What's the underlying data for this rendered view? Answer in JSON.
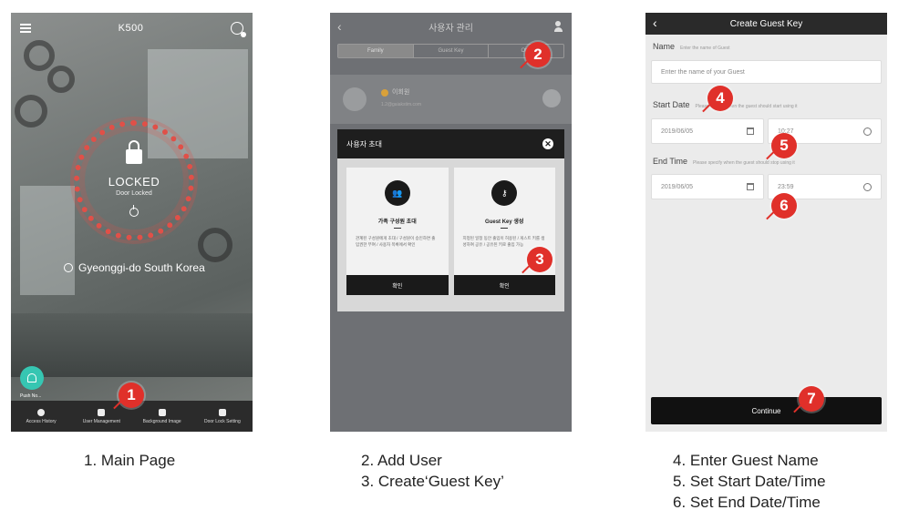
{
  "screen1": {
    "title": "K500",
    "lock_status": "LOCKED",
    "lock_sub": "Door Locked",
    "location": "Gyeonggi-do South Korea",
    "fab_label": "Push No...",
    "tabs": [
      {
        "label": "Access History",
        "icon": "clock-icon"
      },
      {
        "label": "User Management",
        "icon": "users-icon"
      },
      {
        "label": "Background Image",
        "icon": "image-icon"
      },
      {
        "label": "Door Lock Setting",
        "icon": "settings-icon"
      }
    ],
    "marker": "1"
  },
  "screen2": {
    "title": "사용자 관리",
    "segments": [
      "Family",
      "Guest Key",
      "Ot..."
    ],
    "member_name": "이회원",
    "member_email": "1.2@gaiakstim.com",
    "dialog_title": "사용자 초대",
    "cards": [
      {
        "title": "가족 구성원 초대",
        "desc": "관계된 구성원에게 초대 / 구성원이 승인하면 출입권한 부여 / 사용자 목록에서 확인",
        "button": "확인",
        "icon": "users-icon"
      },
      {
        "title": "Guest Key 생성",
        "desc": "지정된 일정 동안 출입이 허용된 / 게스트 키를 생성하여 공유 / 공유된 키로 출입 가능",
        "button": "확인",
        "icon": "key-icon"
      }
    ],
    "markers": [
      "2",
      "3"
    ]
  },
  "screen3": {
    "title": "Create Guest Key",
    "name_label": "Name",
    "name_hint": "Enter the name of Guest",
    "name_placeholder": "Enter the name of your Guest",
    "start_label": "Start Date",
    "start_hint": "Please specify when the guest should start using it",
    "start_date": "2019/06/05",
    "start_time": "10:27",
    "end_label": "End Time",
    "end_hint": "Please specify when the guest should stop using it",
    "end_date": "2019/06/05",
    "end_time": "23:59",
    "continue_label": "Continue",
    "markers": [
      "4",
      "5",
      "6",
      "7"
    ]
  },
  "captions": {
    "c1": "1. Main Page",
    "c2_line1": "2. Add User",
    "c2_line2": "3. Create‘Guest Key’",
    "c3_line1": "4. Enter Guest Name",
    "c3_line2": "5. Set Start Date/Time",
    "c3_line3": "6. Set End Date/Time"
  }
}
